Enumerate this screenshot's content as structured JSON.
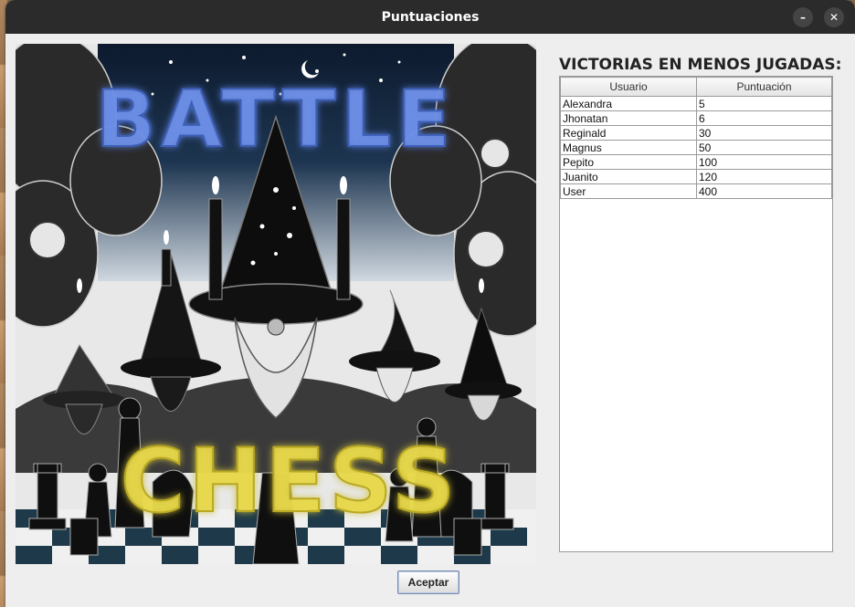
{
  "window": {
    "title": "Puntuaciones",
    "minimize_icon": "minimize-icon",
    "close_icon": "close-icon"
  },
  "image": {
    "subject": "battle-chess-artwork",
    "top_text": "BATTLE",
    "bottom_text": "CHESS",
    "top_text_color": "#6d8fe8",
    "bottom_text_color": "#e8d84a"
  },
  "scores": {
    "title": "VICTORIAS EN MENOS JUGADAS:",
    "columns": [
      "Usuario",
      "Puntuación"
    ],
    "rows": [
      [
        "Alexandra",
        "5"
      ],
      [
        "Jhonatan",
        "6"
      ],
      [
        "Reginald",
        "30"
      ],
      [
        "Magnus",
        "50"
      ],
      [
        "Pepito",
        "100"
      ],
      [
        "Juanito",
        "120"
      ],
      [
        "User",
        "400"
      ]
    ]
  },
  "footer": {
    "accept_label": "Aceptar"
  }
}
